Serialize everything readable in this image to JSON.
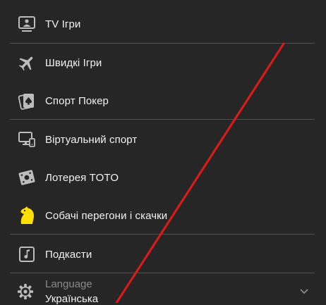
{
  "menu": {
    "items": [
      {
        "label": "TV Ігри",
        "icon": "tv-games-icon"
      },
      {
        "label": "Швидкі Ігри",
        "icon": "airplane-icon"
      },
      {
        "label": "Спорт Покер",
        "icon": "poker-cards-icon"
      },
      {
        "label": "Віртуальний спорт",
        "icon": "virtual-sport-icon"
      },
      {
        "label": "Лотерея TOTO",
        "icon": "lottery-ticket-icon"
      },
      {
        "label": "Собачі перегони і скачки",
        "icon": "horse-head-icon"
      },
      {
        "label": "Подкасти",
        "icon": "podcast-icon"
      }
    ]
  },
  "language": {
    "title": "Language",
    "value": "Українська",
    "icon": "gear-icon"
  },
  "colors": {
    "background": "#262626",
    "text": "#f2f2f2",
    "icon": "#bdbdbd",
    "horse_accent": "#ffe000",
    "annotation_arrow": "#e01919"
  }
}
